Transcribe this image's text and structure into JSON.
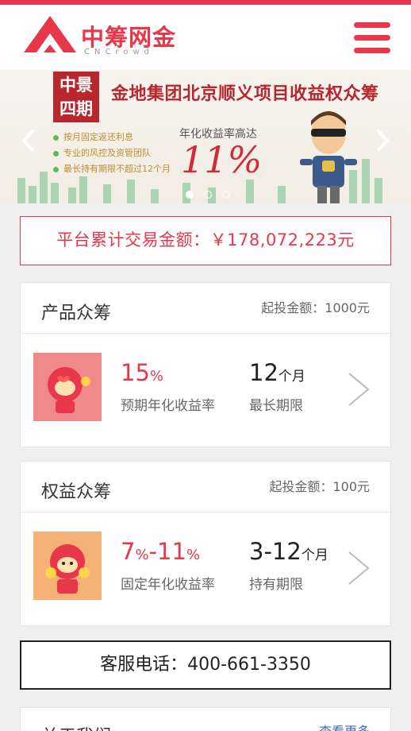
{
  "brand": {
    "name": "中筹网金",
    "sub": "CNCrowd"
  },
  "banner": {
    "tag_line1": "中景",
    "tag_line2": "四期",
    "title": "金地集团北京顺义项目收益权众筹",
    "features": [
      "按月固定返还利息",
      "专业的风控及资管团队",
      "最长持有期限不超过12个月"
    ],
    "rate_caption": "年化收益率高达",
    "rate_value": "11%",
    "prev_icon": "chevron-left-icon",
    "next_icon": "chevron-right-icon"
  },
  "total": {
    "label": "平台累计交易金额：",
    "amount": "￥178,072,223元"
  },
  "products": [
    {
      "title": "产品众筹",
      "min_label": "起投金额：",
      "min_value": "1000元",
      "rate_num": "15",
      "rate_unit": "%",
      "rate_label": "预期年化收益率",
      "term_num": "12",
      "term_unit": "个月",
      "term_label": "最长期限",
      "thumb_bg": "#f08a8a"
    },
    {
      "title": "权益众筹",
      "min_label": "起投金额：",
      "min_value": "100元",
      "rate_num1": "7",
      "rate_unit1": "%",
      "rate_sep": "-",
      "rate_num2": "11",
      "rate_unit2": "%",
      "rate_label": "固定年化收益率",
      "term_num": "3-12",
      "term_unit": "个月",
      "term_label": "持有期限",
      "thumb_bg": "#f6b177"
    }
  ],
  "hotline": {
    "label": "客服电话：",
    "number": "400-661-3350"
  },
  "about": {
    "title": "关于我们",
    "more": "查看更多"
  },
  "colors": {
    "accent": "#e8374a",
    "banner_red": "#b8262e"
  }
}
